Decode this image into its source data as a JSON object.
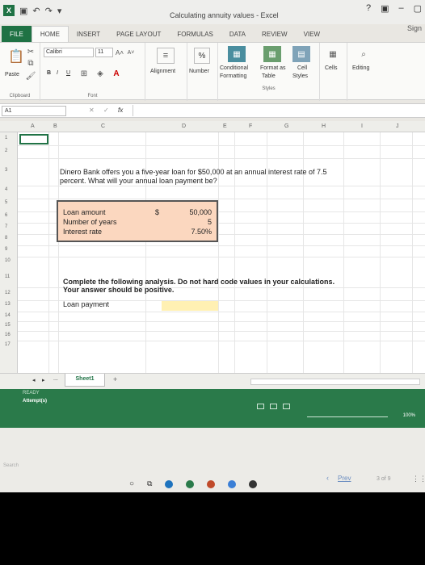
{
  "window": {
    "title": "Calculating annuity values - Excel",
    "help": "?",
    "sign_in": "Sign"
  },
  "tabs": [
    "FILE",
    "HOME",
    "INSERT",
    "PAGE LAYOUT",
    "FORMULAS",
    "DATA",
    "REVIEW",
    "VIEW"
  ],
  "ribbon": {
    "paste_label": "Paste",
    "clipboard_label": "Clipboard",
    "font_name": "Calibri",
    "font_size": "11",
    "font_group_label": "Font",
    "bold": "B",
    "italic": "I",
    "underline": "U",
    "alignment_label": "Alignment",
    "number_label": "Number",
    "percent_symbol": "%",
    "conditional_formatting_1": "Conditional",
    "conditional_formatting_2": "Formatting",
    "format_table_1": "Format as",
    "format_table_2": "Table",
    "cell_styles_1": "Cell",
    "cell_styles_2": "Styles",
    "styles_label": "Styles",
    "cells_label": "Cells",
    "editing_label": "Editing"
  },
  "formula_bar": {
    "name_box": "A1",
    "fx": "fx",
    "cancel": "✕",
    "enter": "✓"
  },
  "grid": {
    "columns": [
      "A",
      "B",
      "C",
      "D",
      "E",
      "F",
      "G",
      "H",
      "I",
      "J"
    ],
    "rows": [
      "1",
      "2",
      "3",
      "4",
      "5",
      "6",
      "7",
      "8",
      "9",
      "10",
      "11",
      "12",
      "13",
      "14",
      "15",
      "16",
      "17"
    ]
  },
  "sheet": {
    "problem_line1": "Dinero Bank offers you a five-year loan for $50,000 at an annual interest rate of 7.5",
    "problem_line2": "percent. What will your annual loan payment be?",
    "inputs": [
      {
        "label": "Loan amount",
        "prefix": "$",
        "value": "50,000"
      },
      {
        "label": "Number of years",
        "prefix": "",
        "value": "5"
      },
      {
        "label": "Interest rate",
        "prefix": "",
        "value": "7.50%"
      }
    ],
    "instruction_line1": "Complete the following analysis. Do not hard code values in your calculations.",
    "instruction_line2": "Your answer should be positive.",
    "loan_payment_label": "Loan payment"
  },
  "sheet_tabs": {
    "dots": "...",
    "sheet1": "Sheet1",
    "add": "+"
  },
  "status": {
    "ready": "READY",
    "attempts": "Attempt(s)",
    "zoom": "100%"
  },
  "page_nav": {
    "search": "Search",
    "prev": "Prev",
    "page_info": "3 of 9"
  },
  "colors": {
    "excel_green": "#1f7244",
    "status_green": "#2a7a4a",
    "input_fill": "#fbd7bf",
    "answer_fill": "#fff0b3"
  }
}
